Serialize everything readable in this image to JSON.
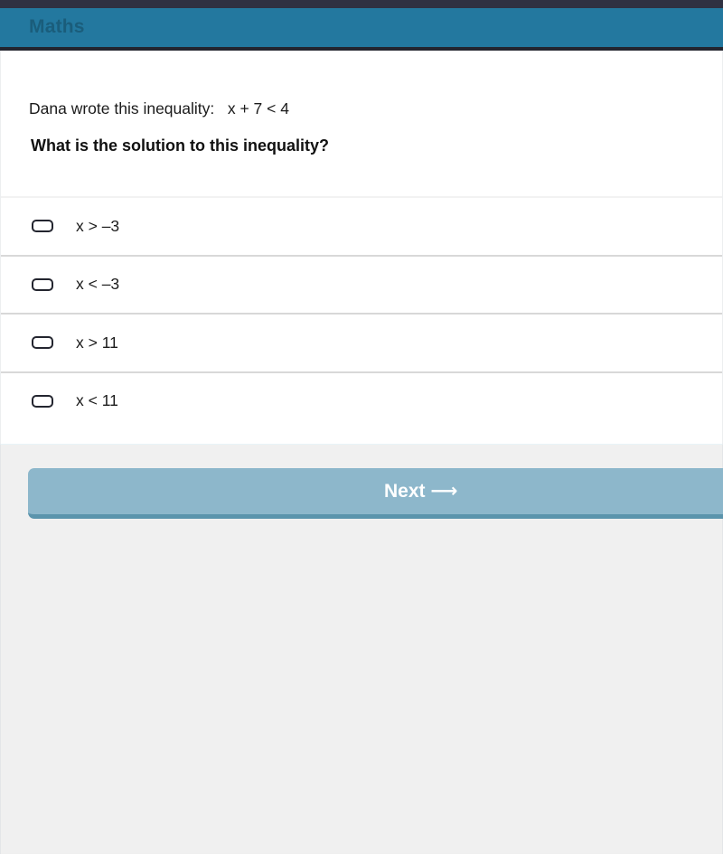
{
  "header": {
    "subject_title": "Maths",
    "bar_color": "#23789f",
    "title_color": "#1a5d7b",
    "top_strip_color": "#2f3142"
  },
  "question": {
    "stem": "Dana wrote this inequality:   x + 7 < 4",
    "prompt": "What is the solution to this inequality?"
  },
  "options": [
    {
      "label": "x > –3",
      "checkbox": "checkbox-unchecked-icon",
      "checked": false
    },
    {
      "label": "x < –3",
      "checkbox": "checkbox-unchecked-icon",
      "checked": false
    },
    {
      "label": "x > 11",
      "checkbox": "checkbox-unchecked-icon",
      "checked": false
    },
    {
      "label": "x < 11",
      "checkbox": "checkbox-unchecked-icon",
      "checked": false
    }
  ],
  "footer": {
    "next_label": "Next ⟶",
    "button_color": "#8db7cb",
    "button_shadow_color": "#5b94ac",
    "panel_color": "#f0f0f0"
  }
}
